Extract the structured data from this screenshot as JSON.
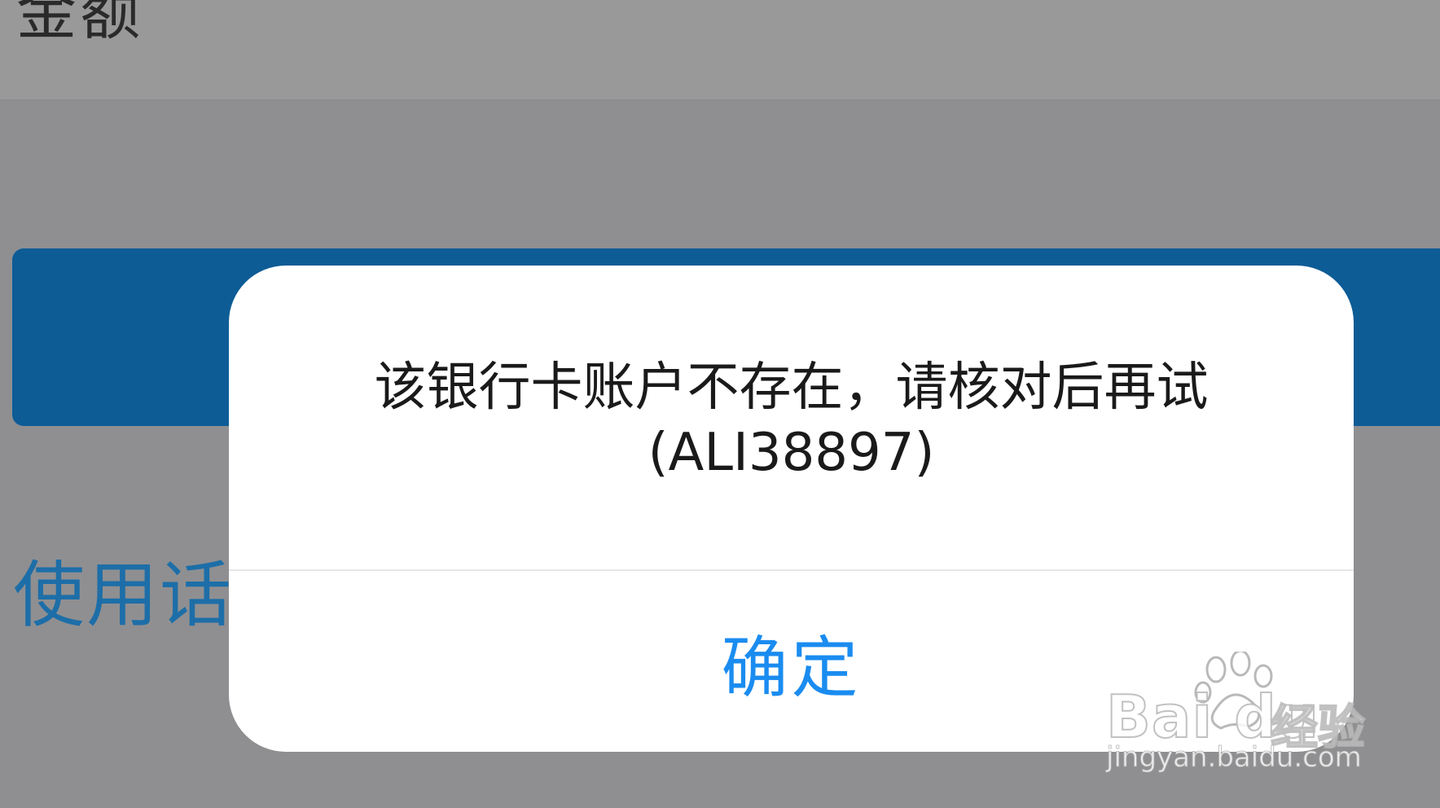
{
  "background": {
    "top_label": "金额",
    "link_label": "使用话"
  },
  "dialog": {
    "message_line1": "该银行卡账户不存在，请核对后再试",
    "message_line2": "(ALI38897)",
    "confirm_label": "确定"
  },
  "watermark": {
    "brand": "Bai du",
    "brand_cn": "经验",
    "url": "jingyan.baidu.com"
  },
  "colors": {
    "overlay_gray": "#8f8f91",
    "primary_button_blue": "#0d5c96",
    "link_blue": "#1d6ea8",
    "confirm_blue": "#1a8cf0",
    "dialog_bg": "#ffffff"
  }
}
